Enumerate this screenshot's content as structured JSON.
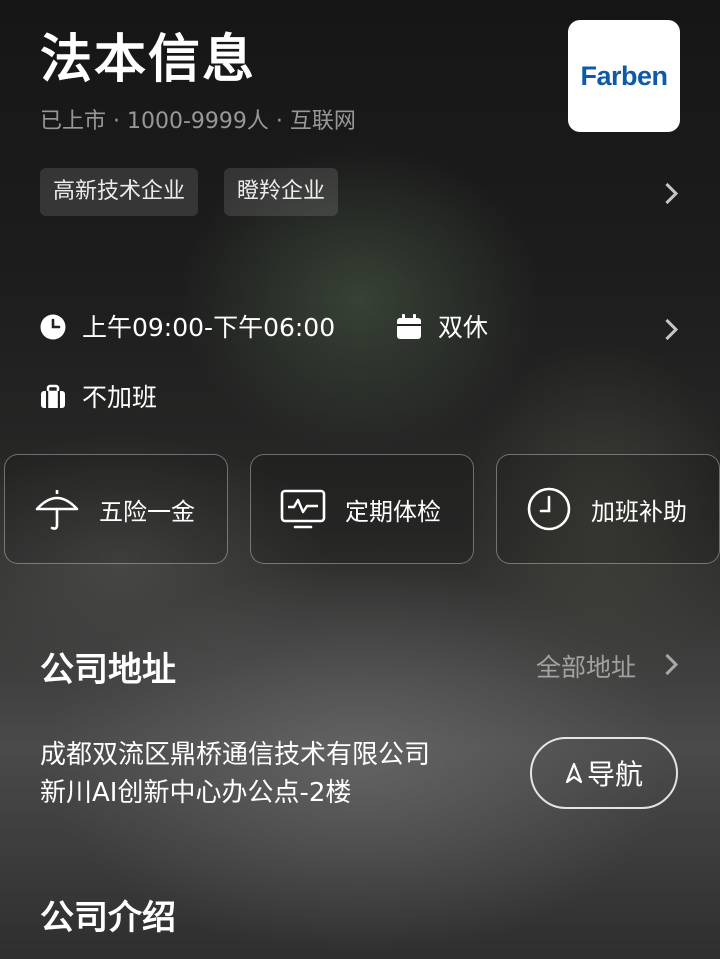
{
  "company": {
    "name": "法本信息",
    "meta": "已上市 · 1000-9999人 · 互联网",
    "logo_text": "Farben",
    "tags": [
      "高新技术企业",
      "瞪羚企业"
    ]
  },
  "work": {
    "hours": "上午09:00-下午06:00",
    "weekend": "双休",
    "overtime": "不加班"
  },
  "benefits": [
    {
      "label": "五险一金",
      "icon": "umbrella-icon"
    },
    {
      "label": "定期体检",
      "icon": "monitor-pulse-icon"
    },
    {
      "label": "加班补助",
      "icon": "clock-icon"
    }
  ],
  "address_section": {
    "title": "公司地址",
    "all_link": "全部地址",
    "line1": "成都双流区鼎桥通信技术有限公司",
    "line2": "新川AI创新中心办公点-2楼",
    "nav_label": "导航"
  },
  "intro_section": {
    "title": "公司介绍"
  },
  "colors": {
    "logo_blue": "#0e5aa7"
  }
}
